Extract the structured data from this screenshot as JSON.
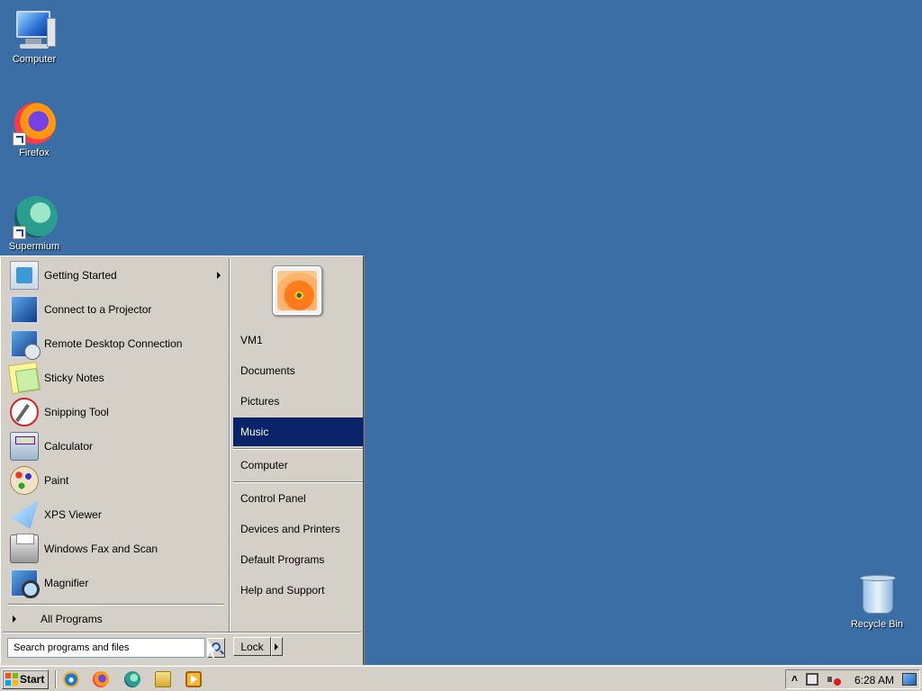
{
  "desktop": {
    "icons": [
      {
        "label": "Computer",
        "icon": "computer-icon"
      },
      {
        "label": "Firefox",
        "icon": "firefox-icon"
      },
      {
        "label": "Supermium",
        "icon": "supermium-icon"
      },
      {
        "label": "Recycle Bin",
        "icon": "recycle-bin-icon"
      }
    ],
    "background_color": "#3a6ea5"
  },
  "start_menu": {
    "programs": [
      {
        "label": "Getting Started",
        "icon": "getting-started-icon",
        "has_submenu": true
      },
      {
        "label": "Connect to a Projector",
        "icon": "projector-icon"
      },
      {
        "label": "Remote Desktop Connection",
        "icon": "remote-desktop-icon"
      },
      {
        "label": "Sticky Notes",
        "icon": "sticky-notes-icon"
      },
      {
        "label": "Snipping Tool",
        "icon": "snipping-tool-icon"
      },
      {
        "label": "Calculator",
        "icon": "calculator-icon"
      },
      {
        "label": "Paint",
        "icon": "paint-icon"
      },
      {
        "label": "XPS Viewer",
        "icon": "xps-viewer-icon"
      },
      {
        "label": "Windows Fax and Scan",
        "icon": "fax-scan-icon"
      },
      {
        "label": "Magnifier",
        "icon": "magnifier-icon"
      }
    ],
    "all_programs_label": "All Programs",
    "search_placeholder": "Search programs and files",
    "right_items": [
      {
        "label": "VM1"
      },
      {
        "label": "Documents"
      },
      {
        "label": "Pictures"
      },
      {
        "label": "Music",
        "highlighted": true
      },
      {
        "label": "Computer"
      },
      {
        "label": "Control Panel"
      },
      {
        "label": "Devices and Printers"
      },
      {
        "label": "Default Programs"
      },
      {
        "label": "Help and Support"
      }
    ],
    "lock_label": "Lock",
    "highlight_color": "#0a246a"
  },
  "taskbar": {
    "start_label": "Start",
    "quick_launch": [
      {
        "icon": "internet-explorer-icon"
      },
      {
        "icon": "firefox-icon"
      },
      {
        "icon": "supermium-icon"
      },
      {
        "icon": "windows-explorer-icon"
      },
      {
        "icon": "media-player-icon"
      }
    ],
    "tray": {
      "chevron": "˄",
      "clock": "6:28 AM"
    }
  }
}
